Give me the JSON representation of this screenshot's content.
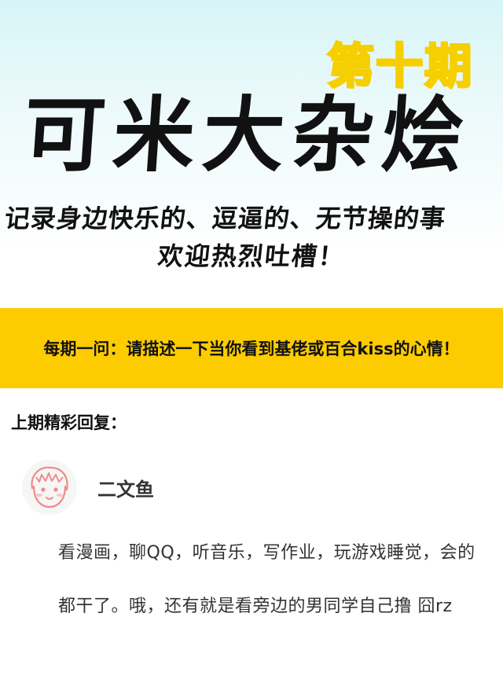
{
  "header": {
    "issue_label": "第十期",
    "title": "可米大杂烩",
    "subtitle_line1": "记录身边快乐的、逗逼的、无节操的事",
    "subtitle_line2": "欢迎热烈吐槽！"
  },
  "question": {
    "text": "每期一问：请描述一下当你看到基佬或百合kiss的心情！"
  },
  "last_issue": {
    "label": "上期精彩回复："
  },
  "comment": {
    "username": "二文鱼",
    "text": "看漫画，聊QQ，听音乐，写作业，玩游戏睡觉，会的都干了。哦，还有就是看旁边的男同学自己撸 囧rz"
  },
  "colors": {
    "accent_yellow": "#fccc00",
    "header_sky": "#d7f5f7",
    "text_dark": "#111111",
    "avatar_outline": "#f08a8a"
  }
}
